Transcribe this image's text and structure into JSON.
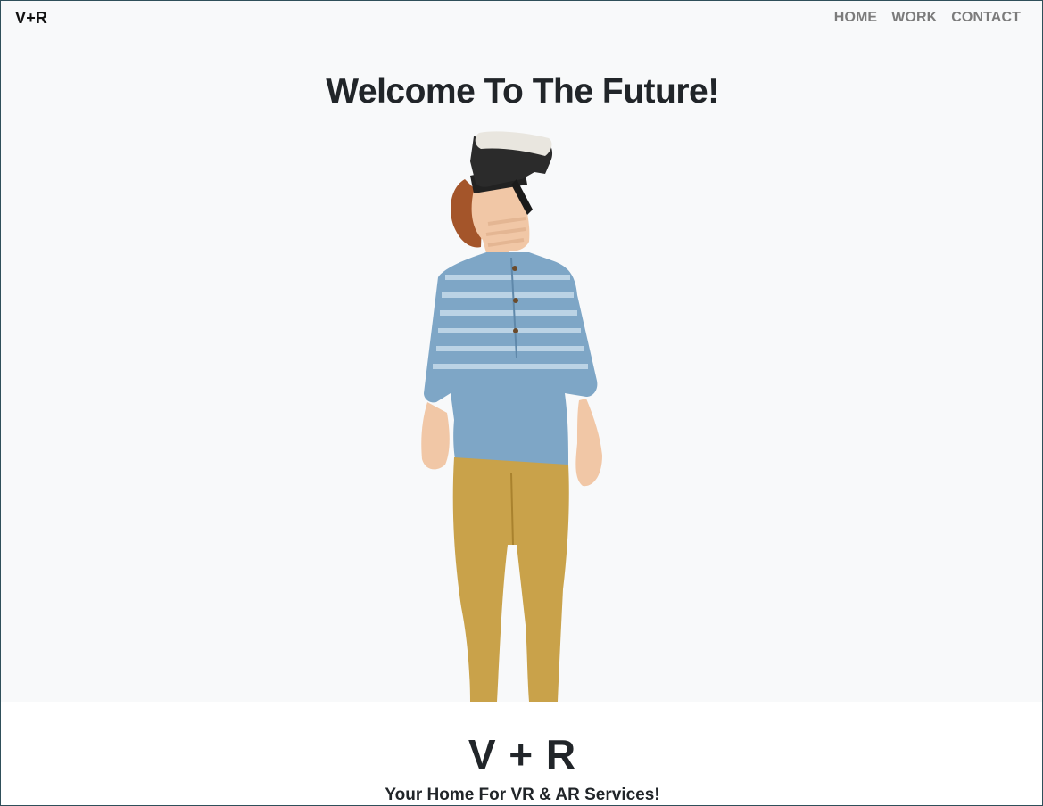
{
  "navbar": {
    "brand": "V+R",
    "links": [
      {
        "label": "HOME"
      },
      {
        "label": "WORK"
      },
      {
        "label": "CONTACT"
      }
    ]
  },
  "hero": {
    "title": "Welcome To The Future!",
    "image_description": "boy-wearing-vr-headset"
  },
  "section": {
    "brand_large": "V + R",
    "tagline": "Your Home For VR & AR Services!"
  },
  "colors": {
    "hero_bg": "#f8f9fa",
    "text": "#212529",
    "nav_link": "#7b7b7b"
  }
}
